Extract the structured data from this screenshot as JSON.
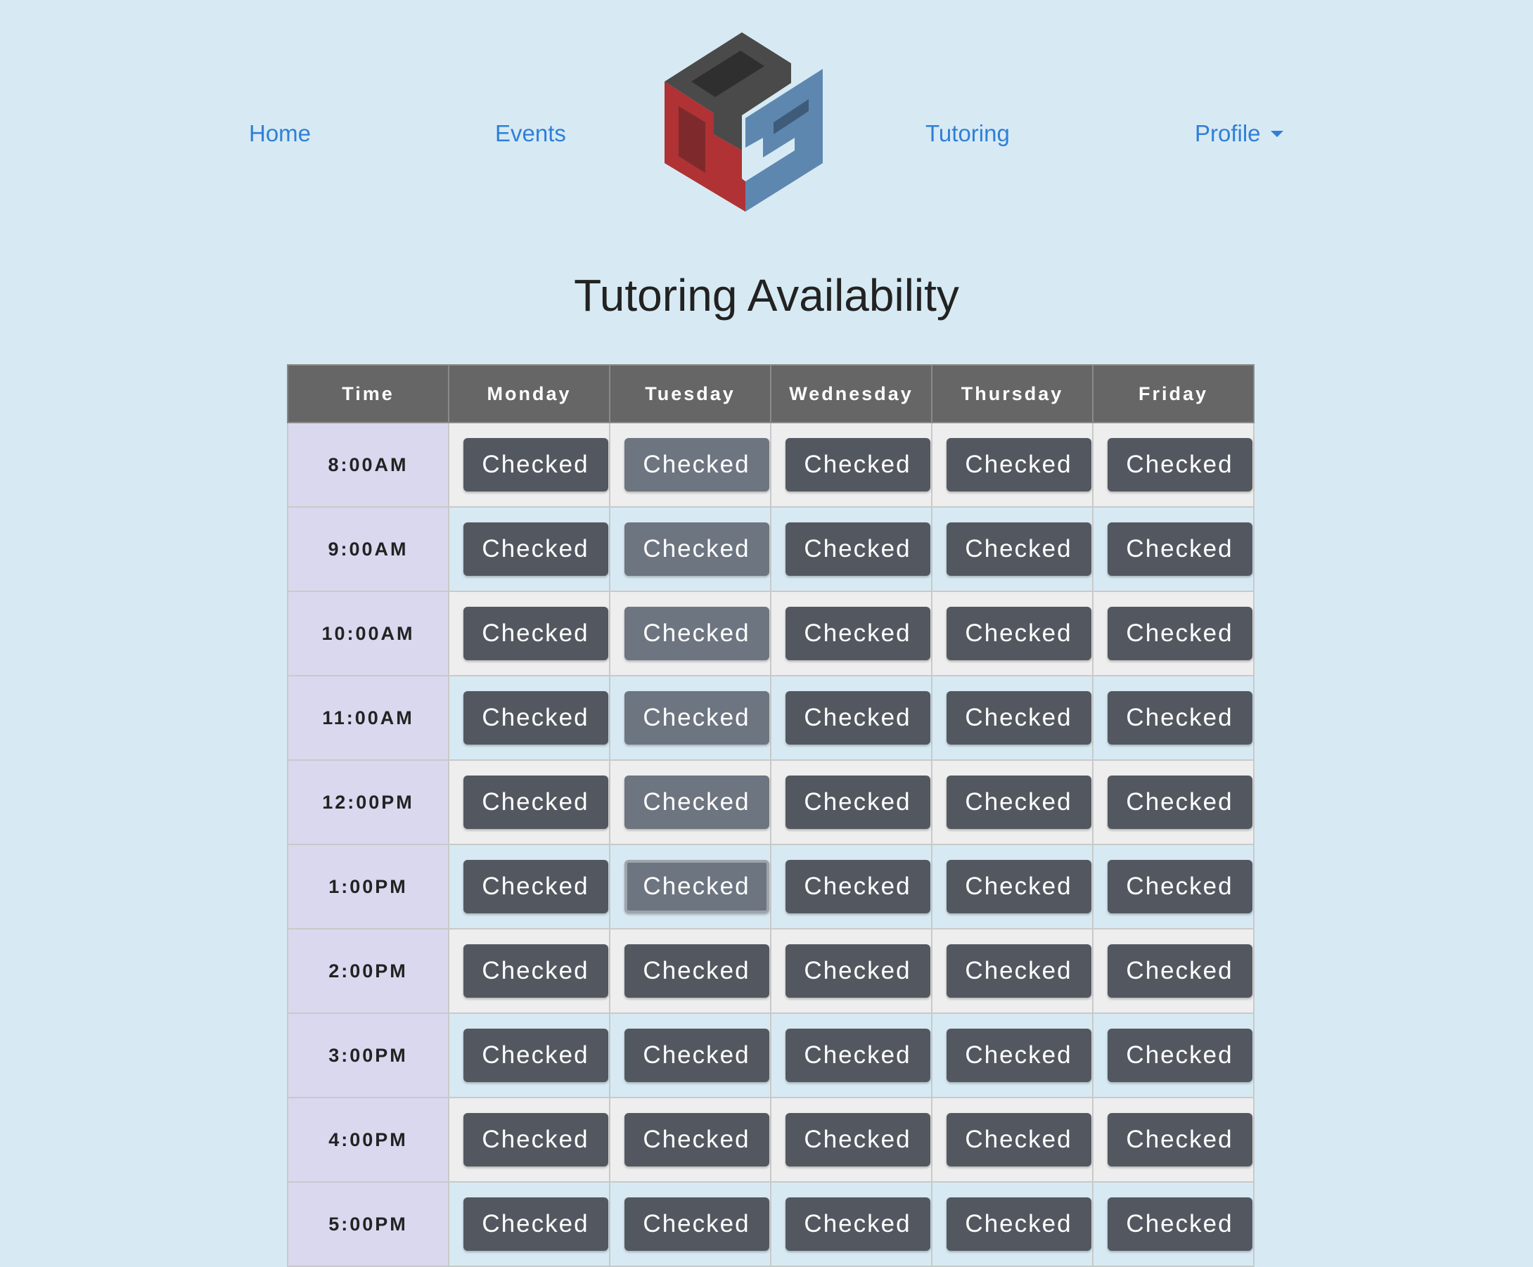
{
  "nav": {
    "home": "Home",
    "events": "Events",
    "tutoring": "Tutoring",
    "profile": "Profile"
  },
  "logo": {
    "icon": "cps-cube-logo",
    "colors": {
      "dark": "#4a4a4a",
      "red": "#b03234",
      "blue": "#5e87b0"
    }
  },
  "page": {
    "title": "Tutoring Availability"
  },
  "table": {
    "headers": [
      "Time",
      "Monday",
      "Tuesday",
      "Wednesday",
      "Thursday",
      "Friday"
    ],
    "rows": [
      {
        "time": "8:00AM",
        "slots": [
          "Checked",
          "Checked",
          "Checked",
          "Checked",
          "Checked"
        ]
      },
      {
        "time": "9:00AM",
        "slots": [
          "Checked",
          "Checked",
          "Checked",
          "Checked",
          "Checked"
        ]
      },
      {
        "time": "10:00AM",
        "slots": [
          "Checked",
          "Checked",
          "Checked",
          "Checked",
          "Checked"
        ]
      },
      {
        "time": "11:00AM",
        "slots": [
          "Checked",
          "Checked",
          "Checked",
          "Checked",
          "Checked"
        ]
      },
      {
        "time": "12:00PM",
        "slots": [
          "Checked",
          "Checked",
          "Checked",
          "Checked",
          "Checked"
        ]
      },
      {
        "time": "1:00PM",
        "slots": [
          "Checked",
          "Checked",
          "Checked",
          "Checked",
          "Checked"
        ]
      },
      {
        "time": "2:00PM",
        "slots": [
          "Checked",
          "Checked",
          "Checked",
          "Checked",
          "Checked"
        ]
      },
      {
        "time": "3:00PM",
        "slots": [
          "Checked",
          "Checked",
          "Checked",
          "Checked",
          "Checked"
        ]
      },
      {
        "time": "4:00PM",
        "slots": [
          "Checked",
          "Checked",
          "Checked",
          "Checked",
          "Checked"
        ]
      },
      {
        "time": "5:00PM",
        "slots": [
          "Checked",
          "Checked",
          "Checked",
          "Checked",
          "Checked"
        ]
      }
    ]
  },
  "colors": {
    "background": "#d7eaf3",
    "link": "#2f7fd9",
    "header_bg": "#666666",
    "time_cell_bg": "#d9d8ee",
    "button_dark": "#535860",
    "button_light": "#6d7580"
  }
}
